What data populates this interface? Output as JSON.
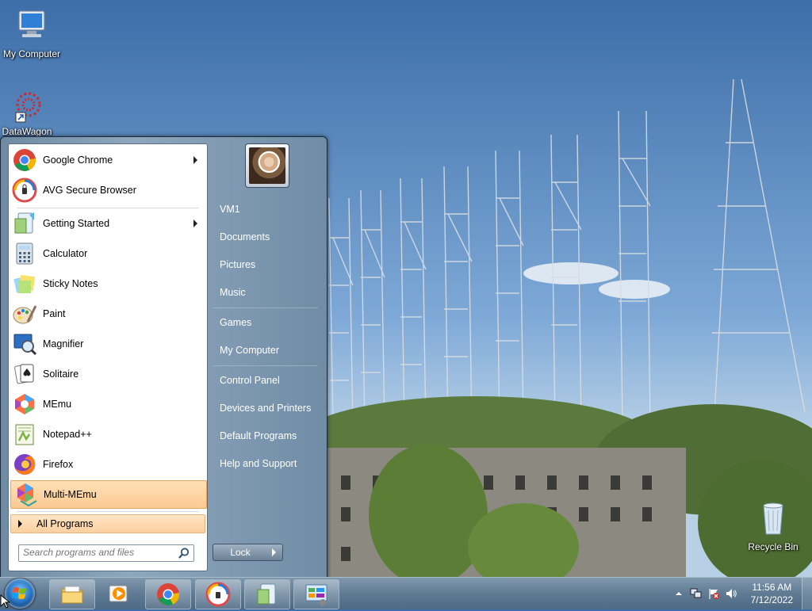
{
  "desktop": {
    "icons": [
      {
        "label": "My Computer"
      },
      {
        "label": "DataWagon"
      },
      {
        "label": "Recycle Bin"
      }
    ]
  },
  "start_menu": {
    "programs": [
      {
        "label": "Google Chrome",
        "icon": "chrome-icon",
        "has_submenu": true
      },
      {
        "label": "AVG Secure Browser",
        "icon": "avg-browser-icon",
        "has_submenu": false
      },
      {
        "label": "Getting Started",
        "icon": "getting-started-icon",
        "has_submenu": true
      },
      {
        "label": "Calculator",
        "icon": "calculator-icon",
        "has_submenu": false
      },
      {
        "label": "Sticky Notes",
        "icon": "sticky-notes-icon",
        "has_submenu": false
      },
      {
        "label": "Paint",
        "icon": "paint-icon",
        "has_submenu": false
      },
      {
        "label": "Magnifier",
        "icon": "magnifier-icon",
        "has_submenu": false
      },
      {
        "label": "Solitaire",
        "icon": "solitaire-icon",
        "has_submenu": false
      },
      {
        "label": "MEmu",
        "icon": "memu-icon",
        "has_submenu": false
      },
      {
        "label": "Notepad++",
        "icon": "notepadpp-icon",
        "has_submenu": false
      },
      {
        "label": "Firefox",
        "icon": "firefox-icon",
        "has_submenu": false
      },
      {
        "label": "Multi-MEmu",
        "icon": "multi-memu-icon",
        "has_submenu": false,
        "highlighted": true
      }
    ],
    "all_programs_label": "All Programs",
    "search_placeholder": "Search programs and files",
    "right_items": [
      {
        "label": "VM1"
      },
      {
        "label": "Documents"
      },
      {
        "label": "Pictures"
      },
      {
        "label": "Music"
      },
      {
        "label": "Games"
      },
      {
        "label": "My Computer"
      },
      {
        "label": "Control Panel"
      },
      {
        "label": "Devices and Printers"
      },
      {
        "label": "Default Programs"
      },
      {
        "label": "Help and Support"
      }
    ],
    "lock_label": "Lock"
  },
  "taskbar": {
    "pinned": [
      {
        "icon": "file-explorer-icon"
      },
      {
        "icon": "media-player-icon"
      },
      {
        "icon": "chrome-icon"
      },
      {
        "icon": "avg-browser-icon"
      },
      {
        "icon": "getting-started-icon"
      },
      {
        "icon": "control-panel-icon"
      }
    ],
    "clock": {
      "time": "11:56 AM",
      "date": "7/12/2022"
    }
  },
  "colors": {
    "highlight": "#fcc992",
    "start_menu_bg": "#8ea7bd",
    "taskbar_bg": "#5f7a93"
  }
}
